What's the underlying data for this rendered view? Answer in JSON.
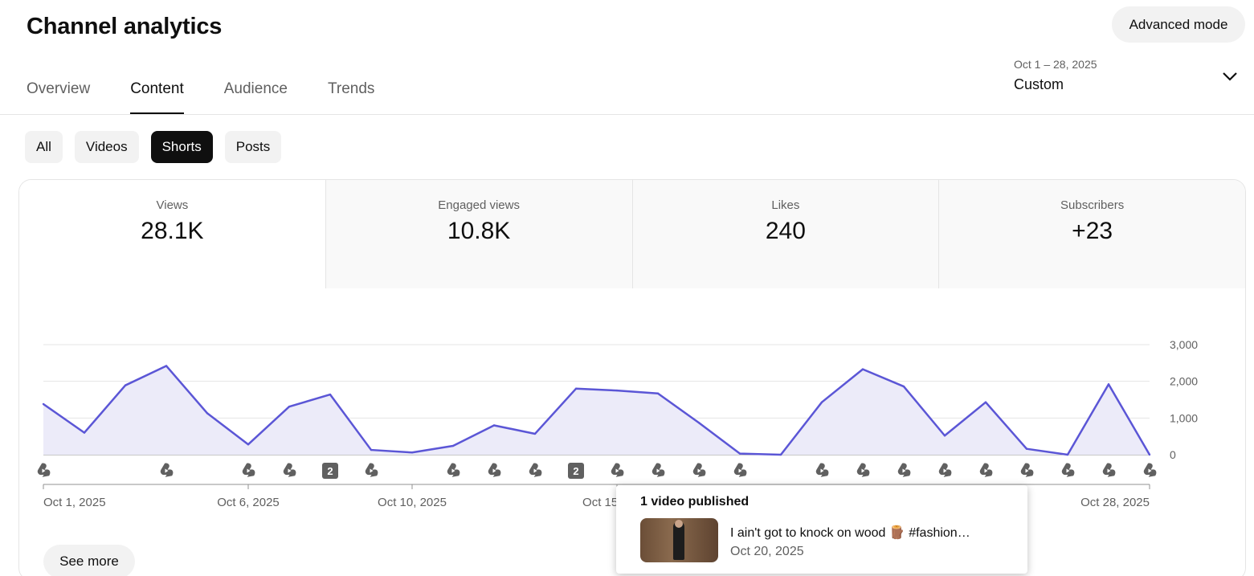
{
  "header": {
    "title": "Channel analytics",
    "advanced_mode_label": "Advanced mode"
  },
  "tabs": [
    {
      "label": "Overview",
      "active": false
    },
    {
      "label": "Content",
      "active": true
    },
    {
      "label": "Audience",
      "active": false
    },
    {
      "label": "Trends",
      "active": false
    }
  ],
  "date_picker": {
    "range": "Oct 1 – 28, 2025",
    "mode": "Custom",
    "icon": "chevron-down-icon"
  },
  "filters": [
    {
      "label": "All",
      "selected": false
    },
    {
      "label": "Videos",
      "selected": false
    },
    {
      "label": "Shorts",
      "selected": true
    },
    {
      "label": "Posts",
      "selected": false
    }
  ],
  "metrics": [
    {
      "label": "Views",
      "value": "28.1K",
      "selected": true
    },
    {
      "label": "Engaged views",
      "value": "10.8K",
      "selected": false
    },
    {
      "label": "Likes",
      "value": "240",
      "selected": false
    },
    {
      "label": "Subscribers",
      "value": "+23",
      "selected": false
    }
  ],
  "colors": {
    "line": "#5b56d6",
    "area": "#ecebf9"
  },
  "chart_data": {
    "type": "area",
    "x": [
      "Oct 1, 2025",
      "Oct 2, 2025",
      "Oct 3, 2025",
      "Oct 4, 2025",
      "Oct 5, 2025",
      "Oct 6, 2025",
      "Oct 7, 2025",
      "Oct 8, 2025",
      "Oct 9, 2025",
      "Oct 10, 2025",
      "Oct 11, 2025",
      "Oct 12, 2025",
      "Oct 13, 2025",
      "Oct 14, 2025",
      "Oct 15, 2025",
      "Oct 16, 2025",
      "Oct 17, 2025",
      "Oct 18, 2025",
      "Oct 19, 2025",
      "Oct 20, 2025",
      "Oct 21, 2025",
      "Oct 22, 2025",
      "Oct 23, 2025",
      "Oct 24, 2025",
      "Oct 25, 2025",
      "Oct 26, 2025",
      "Oct 27, 2025",
      "Oct 28, 2025"
    ],
    "series": [
      {
        "values": [
          1380,
          600,
          1890,
          2420,
          1130,
          280,
          1310,
          1640,
          130,
          60,
          240,
          800,
          570,
          1800,
          1750,
          1670,
          870,
          30,
          0,
          1430,
          2330,
          1860,
          520,
          1430,
          160,
          0,
          1920,
          0
        ]
      }
    ],
    "ylim": [
      0,
      3000
    ],
    "yticks": [
      "3,000",
      "2,000",
      "1,000",
      "0"
    ],
    "yticks_values": [
      3000,
      2000,
      1000,
      0
    ],
    "xtick_labels": [
      {
        "label": "Oct 1, 2025",
        "index": 0
      },
      {
        "label": "Oct 6, 2025",
        "index": 5
      },
      {
        "label": "Oct 10, 2025",
        "index": 9
      },
      {
        "label": "Oct 15, 2025",
        "index": 14
      },
      {
        "label": "Oct 28, 2025",
        "index": 27
      }
    ],
    "publish_markers": [
      {
        "index": 0,
        "count": 1
      },
      {
        "index": 3,
        "count": 1
      },
      {
        "index": 5,
        "count": 1
      },
      {
        "index": 6,
        "count": 1
      },
      {
        "index": 7,
        "count": 2
      },
      {
        "index": 8,
        "count": 1
      },
      {
        "index": 10,
        "count": 1
      },
      {
        "index": 11,
        "count": 1
      },
      {
        "index": 12,
        "count": 1
      },
      {
        "index": 13,
        "count": 2
      },
      {
        "index": 14,
        "count": 1
      },
      {
        "index": 15,
        "count": 1
      },
      {
        "index": 16,
        "count": 1
      },
      {
        "index": 17,
        "count": 1
      },
      {
        "index": 19,
        "count": 1
      },
      {
        "index": 20,
        "count": 1
      },
      {
        "index": 21,
        "count": 1
      },
      {
        "index": 22,
        "count": 1
      },
      {
        "index": 23,
        "count": 1
      },
      {
        "index": 24,
        "count": 1
      },
      {
        "index": 25,
        "count": 1
      },
      {
        "index": 26,
        "count": 1
      },
      {
        "index": 27,
        "count": 1
      }
    ],
    "grid": true
  },
  "see_more_label": "See more",
  "tooltip": {
    "title": "1 video published",
    "video_title": "I ain't got to knock on wood 🪵 #fashion…",
    "video_date": "Oct 20, 2025"
  }
}
